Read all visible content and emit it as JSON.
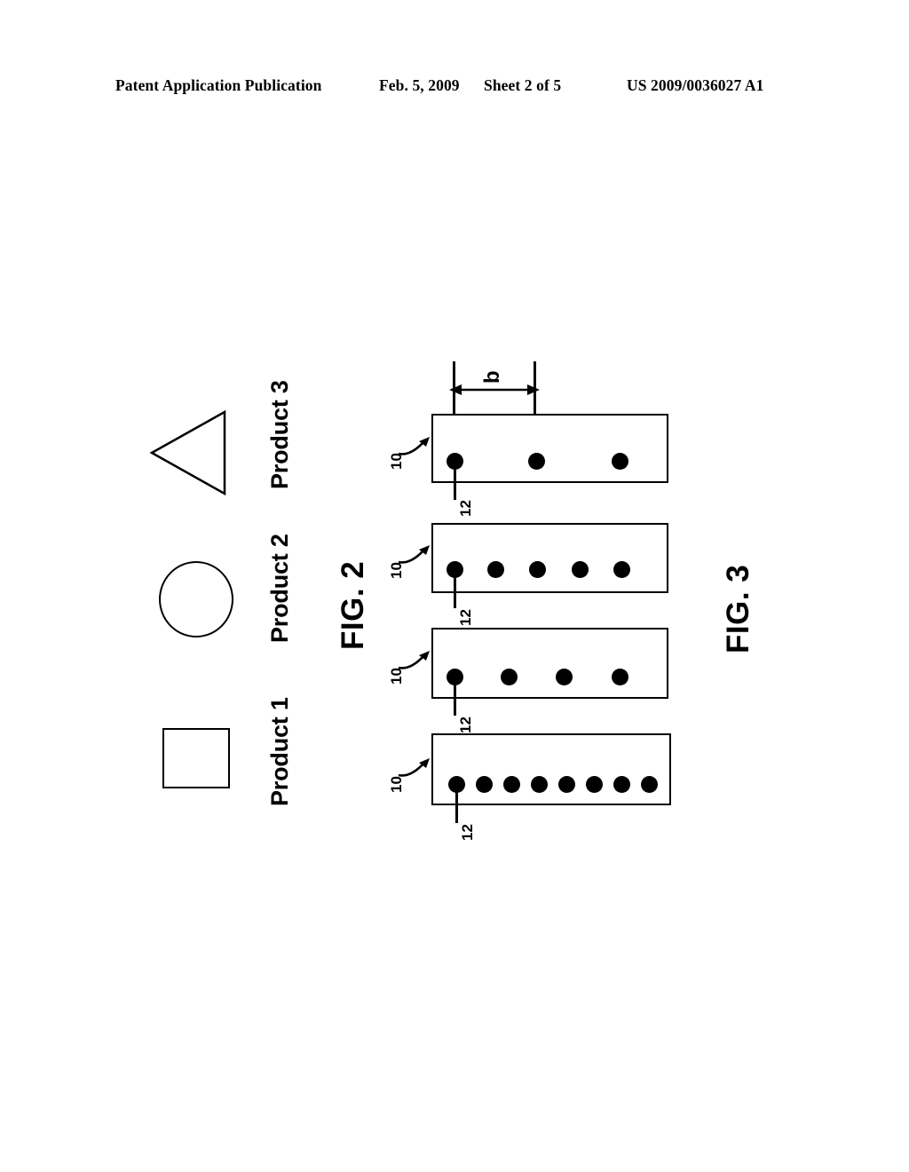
{
  "header": {
    "publication": "Patent Application Publication",
    "date": "Feb. 5, 2009",
    "sheet": "Sheet 2 of 5",
    "patent_number": "US 2009/0036027 A1"
  },
  "figures": [
    {
      "id": "fig2",
      "caption": "FIG. 2",
      "items": [
        {
          "shape": "square",
          "label": "Product 1"
        },
        {
          "shape": "circle",
          "label": "Product 2"
        },
        {
          "shape": "triangle",
          "label": "Product 3"
        }
      ]
    },
    {
      "id": "fig3",
      "caption": "FIG. 3",
      "dimension_label": "b",
      "reference_numerals": {
        "substrate": "10",
        "dot": "12"
      },
      "strips": [
        {
          "dot_count": 3,
          "substrate_ref": "10",
          "dot_ref": "12"
        },
        {
          "dot_count": 5,
          "substrate_ref": "10",
          "dot_ref": "12"
        },
        {
          "dot_count": 4,
          "substrate_ref": "10",
          "dot_ref": "12"
        },
        {
          "dot_count": 8,
          "substrate_ref": "10",
          "dot_ref": "12"
        }
      ]
    }
  ],
  "colors": {
    "ink": "#000000",
    "paper": "#ffffff"
  }
}
